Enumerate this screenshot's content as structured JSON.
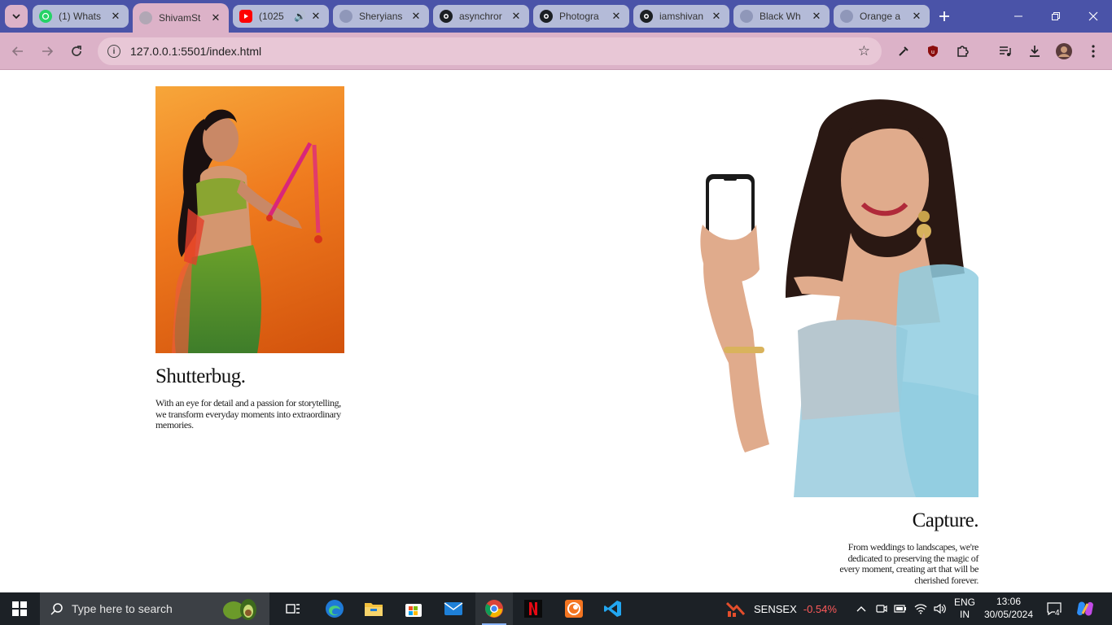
{
  "browser": {
    "tabs": [
      {
        "label": "(1) Whats",
        "icon": "whatsapp-icon",
        "active": false
      },
      {
        "label": "ShivamSt",
        "icon": "globe-icon",
        "active": true
      },
      {
        "label": "(1025",
        "icon": "youtube-icon",
        "active": false,
        "audio": true
      },
      {
        "label": "Sheryians",
        "icon": "globe-icon",
        "active": false
      },
      {
        "label": "asynchror",
        "icon": "github-icon",
        "active": false
      },
      {
        "label": "Photogra",
        "icon": "github-icon",
        "active": false
      },
      {
        "label": "iamshivan",
        "icon": "github-icon",
        "active": false
      },
      {
        "label": "Black Wh",
        "icon": "globe-icon",
        "active": false
      },
      {
        "label": "Orange a",
        "icon": "globe-icon",
        "active": false
      }
    ],
    "url": "127.0.0.1:5501/index.html",
    "colors": {
      "frame": "#4a53a8",
      "toolbar": "#dcb2c8"
    }
  },
  "page": {
    "card1": {
      "title": "Shutterbug.",
      "text": "With an eye for detail and a passion for storytelling, we transform everyday moments into extraordinary memories."
    },
    "card2": {
      "title": "Capture.",
      "text": "From weddings to landscapes, we're dedicated to preserving the magic of every moment, creating art that will be cherished forever."
    }
  },
  "taskbar": {
    "search_placeholder": "Type here to search",
    "apps": [
      "task-view-icon",
      "edge-icon",
      "file-explorer-icon",
      "store-icon",
      "mail-icon",
      "chrome-icon",
      "netflix-icon",
      "crunchyroll-icon",
      "vscode-icon"
    ],
    "sensex": {
      "label": "SENSEX",
      "change": "-0.54%"
    },
    "language": {
      "line1": "ENG",
      "line2": "IN"
    },
    "time": "13:06",
    "date": "30/05/2024",
    "notification_count": "4"
  }
}
